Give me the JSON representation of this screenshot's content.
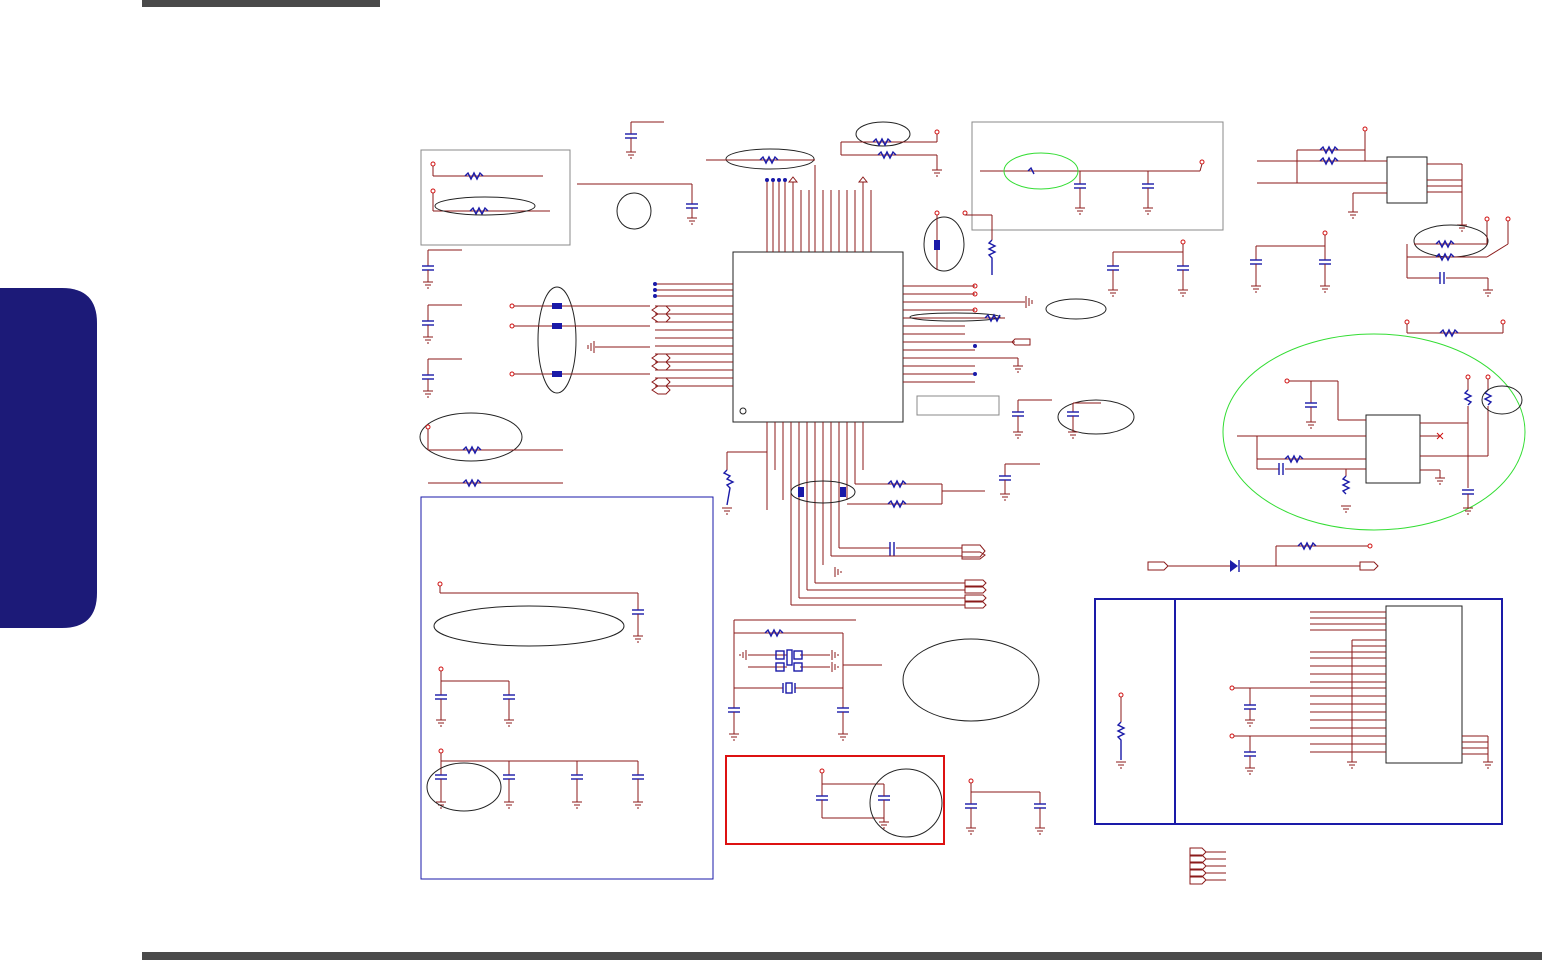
{
  "page": {
    "header_bar_color": "#4a4a4a",
    "footer_bar_color": "#4a4a4a",
    "side_tab_color": "#1c1a78"
  },
  "schematic": {
    "wire_color": "#8b1a1a",
    "bus_color": "#1a1aa8",
    "highlight_green": "#33dd33",
    "highlight_red": "#dd1111",
    "annotation_color": "#000000"
  }
}
